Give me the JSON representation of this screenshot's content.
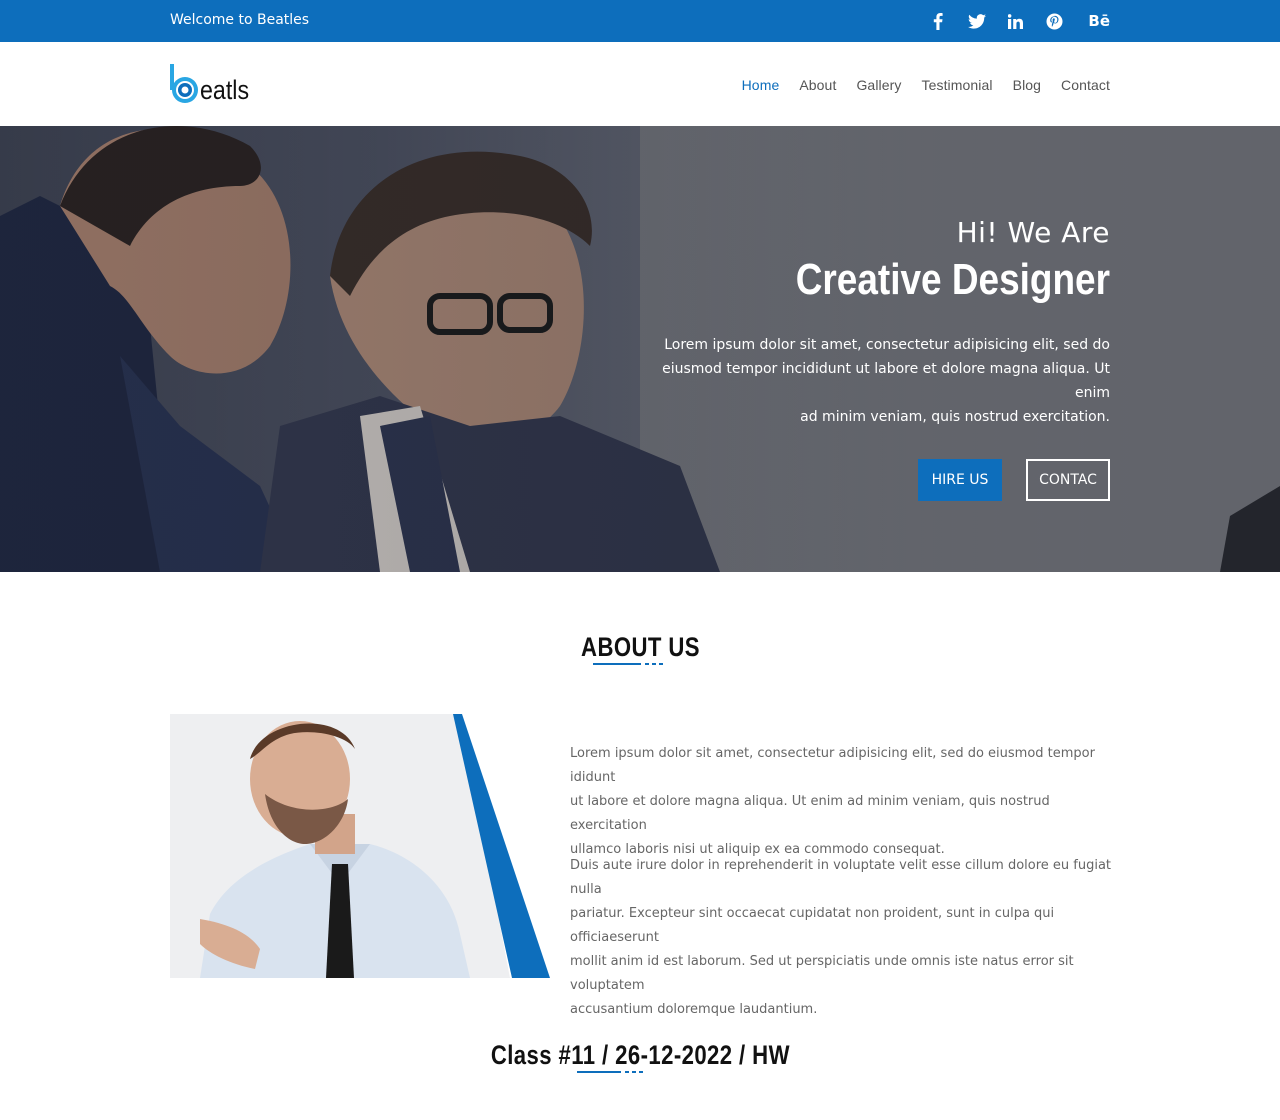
{
  "topbar": {
    "welcome": "Welcome to Beatles",
    "socials": [
      "facebook-icon",
      "twitter-icon",
      "linkedin-icon",
      "pinterest-icon",
      "behance-icon"
    ],
    "behance_label": "Bē"
  },
  "header": {
    "logo_text": "eatls",
    "nav": [
      "Home",
      "About",
      "Gallery",
      "Testimonial",
      "Blog",
      "Contact"
    ],
    "active_nav": "Home"
  },
  "hero": {
    "subtitle": "Hi! We Are",
    "title": "Creative Designer",
    "text_lines": [
      "Lorem ipsum dolor sit amet, consectetur adipisicing elit, sed do",
      "eiusmod tempor incididunt ut labore et dolore magna aliqua. Ut enim",
      "ad minim veniam, quis nostrud exercitation."
    ],
    "hire_label": "HIRE US",
    "contact_label": "CONTAC"
  },
  "about": {
    "title": "ABOUT US",
    "para1_lines": [
      "Lorem ipsum dolor sit amet, consectetur adipisicing elit, sed do eiusmod tempor ididunt",
      "ut labore et dolore magna aliqua. Ut enim ad minim veniam, quis nostrud exercitation",
      "ullamco laboris nisi ut aliquip ex ea commodo consequat."
    ],
    "para2_lines": [
      "Duis aute irure dolor in reprehenderit in voluptate velit esse cillum dolore eu fugiat nulla",
      "pariatur. Excepteur sint occaecat cupidatat non proident, sunt in culpa qui officiaeserunt",
      "mollit anim id est laborum. Sed ut perspiciatis unde omnis iste natus error sit voluptatem",
      "accusantium doloremque laudantium."
    ]
  },
  "footer_heading": "Class #11 / 26-12-2022 / HW",
  "colors": {
    "brand": "#0d6ebc",
    "text_dark": "#111111",
    "text_muted": "#666666"
  }
}
